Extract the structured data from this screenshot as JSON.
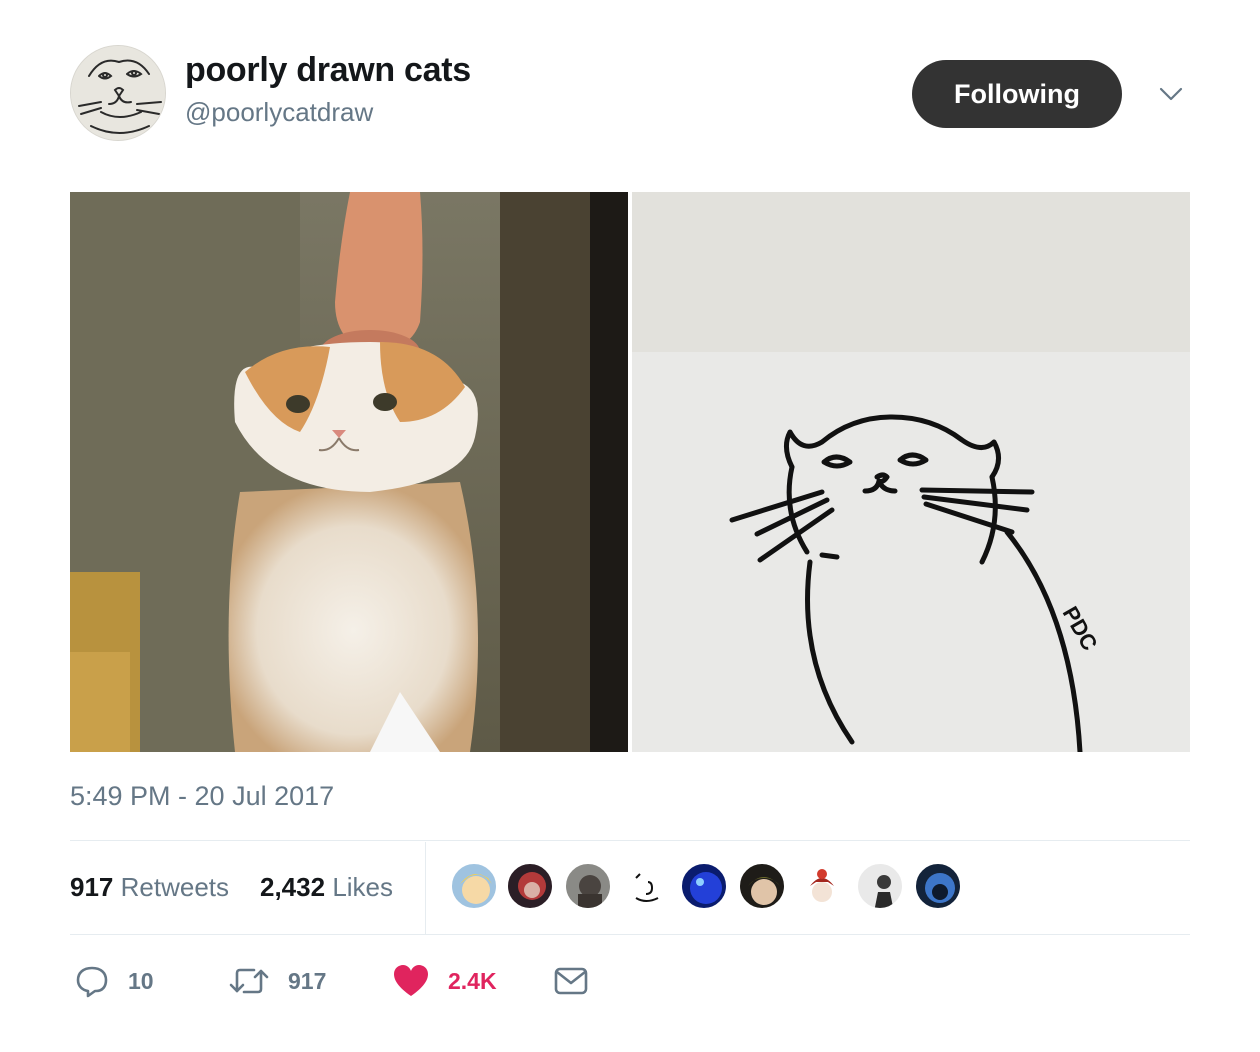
{
  "author": {
    "display_name": "poorly drawn cats",
    "handle": "@poorlycatdraw",
    "follow_label": "Following"
  },
  "tweet": {
    "timestamp": "5:49 PM - 20 Jul 2017",
    "signature_text": "PDC"
  },
  "stats": {
    "retweets_count": "917",
    "retweets_label": "Retweets",
    "likes_count": "2,432",
    "likes_label": "Likes"
  },
  "actions": {
    "reply_count": "10",
    "retweet_count": "917",
    "like_count": "2.4K"
  },
  "colors": {
    "like_red": "#e0245e",
    "muted_text": "#657786",
    "button_dark": "#333333"
  },
  "icons": [
    "avatar-cat-doodle",
    "chevron-down-icon",
    "reply-icon",
    "retweet-icon",
    "heart-icon",
    "envelope-icon"
  ]
}
